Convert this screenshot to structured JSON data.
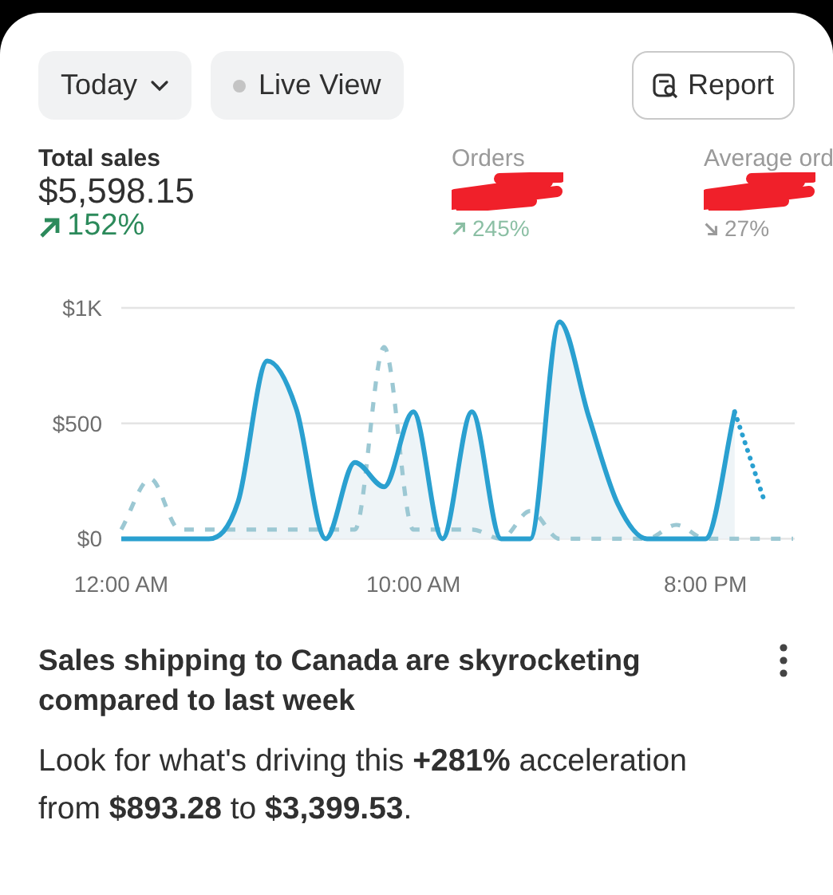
{
  "toolbar": {
    "period": {
      "label": "Today"
    },
    "live_view": {
      "label": "Live View"
    },
    "report": {
      "label": "Report"
    }
  },
  "metrics": [
    {
      "label": "Total sales",
      "value": "$5,598.15",
      "change": "152%",
      "kind": "up",
      "dimmed": false,
      "redacted": false
    },
    {
      "label": "Orders",
      "change": "245%",
      "kind": "up",
      "dimmed": true,
      "redacted": true
    },
    {
      "label": "Average ord",
      "change": "27%",
      "kind": "down",
      "dimmed": true,
      "redacted": true
    }
  ],
  "chart_data": {
    "type": "line",
    "x": [
      0,
      1,
      2,
      3,
      4,
      5,
      6,
      7,
      8,
      9,
      10,
      11,
      12,
      13,
      14,
      15,
      16,
      17,
      18,
      19,
      20,
      21,
      22,
      23
    ],
    "series": [
      {
        "line_style": "solid",
        "color": "#2aa0d0",
        "values": [
          0,
          0,
          0,
          0,
          160,
          770,
          560,
          0,
          330,
          225,
          550,
          0,
          550,
          0,
          0,
          940,
          530,
          150,
          0,
          0,
          0,
          550,
          null,
          null
        ]
      },
      {
        "line_style": "dotted",
        "color": "#2aa0d0",
        "values": [
          null,
          null,
          null,
          null,
          null,
          null,
          null,
          null,
          null,
          null,
          null,
          null,
          null,
          null,
          null,
          null,
          null,
          null,
          null,
          null,
          null,
          550,
          170,
          null
        ]
      },
      {
        "line_style": "dashed",
        "color": "#9cc8d3",
        "values": [
          40,
          260,
          40,
          40,
          40,
          40,
          40,
          40,
          40,
          830,
          40,
          40,
          40,
          0,
          120,
          0,
          0,
          0,
          0,
          60,
          0,
          0,
          0,
          0
        ]
      }
    ],
    "xlim": [
      0,
      23
    ],
    "ylim": [
      0,
      1000
    ],
    "xticks": [
      {
        "value": 0,
        "label": "12:00 AM"
      },
      {
        "value": 10,
        "label": "10:00 AM"
      },
      {
        "value": 20,
        "label": "8:00 PM"
      }
    ],
    "yticks": [
      {
        "value": 0,
        "label": "$0"
      },
      {
        "value": 500,
        "label": "$500"
      },
      {
        "value": 1000,
        "label": "$1K"
      }
    ]
  },
  "insight": {
    "title": "Sales shipping to Canada are skyrocketing compared to last week",
    "body": "Look for what's driving this **+281%** acceleration from **$893.28** to **$3,399.53**."
  }
}
